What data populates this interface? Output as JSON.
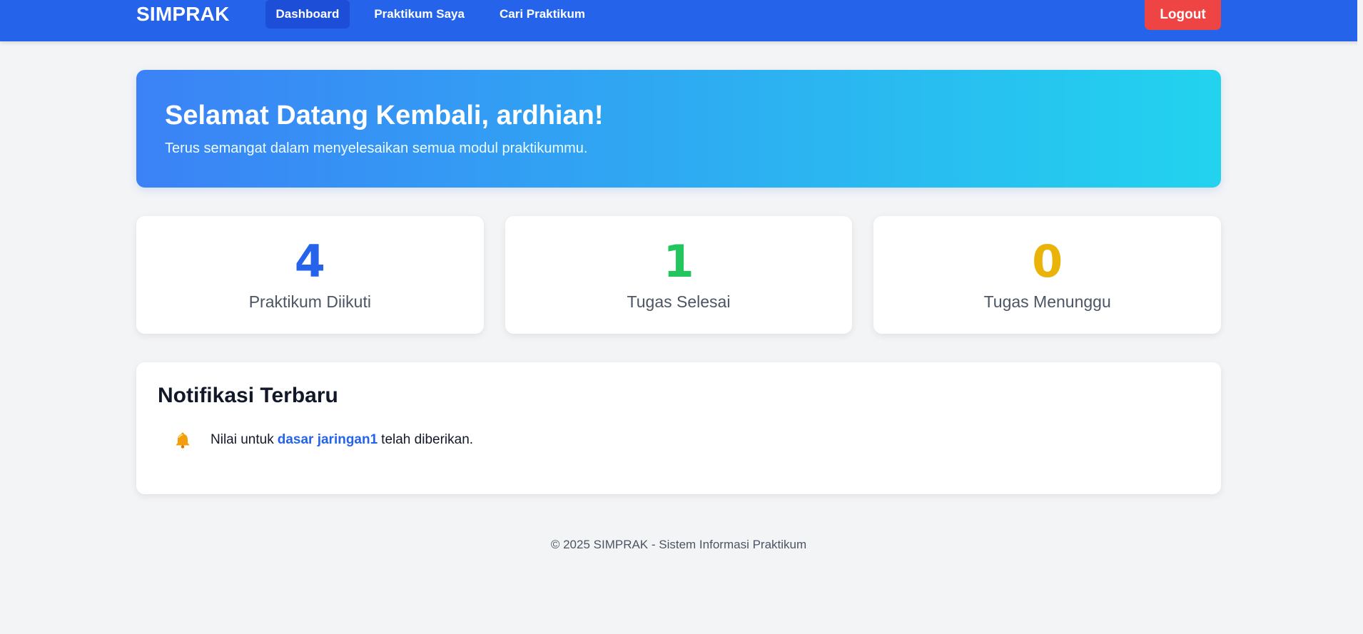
{
  "navbar": {
    "brand": "SIMPRAK",
    "links": [
      {
        "label": "Dashboard",
        "active": true
      },
      {
        "label": "Praktikum Saya",
        "active": false
      },
      {
        "label": "Cari Praktikum",
        "active": false
      }
    ],
    "logout_label": "Logout"
  },
  "hero": {
    "title": "Selamat Datang Kembali, ardhian!",
    "subtitle": "Terus semangat dalam menyelesaikan semua modul praktikummu."
  },
  "stats": [
    {
      "value": "4",
      "label": "Praktikum Diikuti",
      "color": "#2563eb"
    },
    {
      "value": "1",
      "label": "Tugas Selesai",
      "color": "#22c55e"
    },
    {
      "value": "0",
      "label": "Tugas Menunggu",
      "color": "#eab308"
    }
  ],
  "notifications": {
    "title": "Notifikasi Terbaru",
    "items": [
      {
        "icon": "bell-icon",
        "prefix": "Nilai untuk",
        "link": "dasar jaringan1",
        "suffix": "telah diberikan."
      }
    ]
  },
  "footer": {
    "text": "© 2025 SIMPRAK - Sistem Informasi Praktikum"
  },
  "colors": {
    "primary": "#2563eb",
    "logout": "#ef4444",
    "hero_gradient_start": "#3b82f6",
    "hero_gradient_end": "#22d3ee"
  }
}
